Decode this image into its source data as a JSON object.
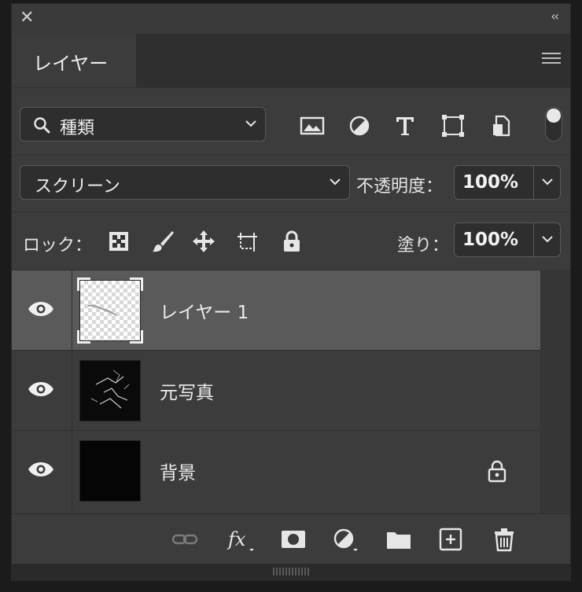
{
  "panel": {
    "tab_label": "レイヤー",
    "filter": {
      "selected": "種類"
    },
    "blend_mode": {
      "selected": "スクリーン"
    },
    "opacity": {
      "label": "不透明度：",
      "value": "100%"
    },
    "lock": {
      "label": "ロック："
    },
    "fill": {
      "label": "塗り：",
      "value": "100%"
    },
    "layers": [
      {
        "name": "レイヤー 1",
        "visible": true,
        "selected": true,
        "locked": false
      },
      {
        "name": "元写真",
        "visible": true,
        "selected": false,
        "locked": false
      },
      {
        "name": "背景",
        "visible": true,
        "selected": false,
        "locked": true
      }
    ],
    "filter_icons": [
      "image-filter-icon",
      "adjustment-filter-icon",
      "type-filter-icon",
      "shape-filter-icon",
      "smart-object-filter-icon"
    ],
    "lock_icons": [
      "lock-transparent-pixels-icon",
      "lock-image-pixels-icon",
      "lock-position-icon",
      "lock-artboard-icon",
      "lock-all-icon"
    ],
    "bottom_icons": [
      "link-layers-icon",
      "fx-icon",
      "add-mask-icon",
      "new-adjustment-layer-icon",
      "new-group-icon",
      "new-layer-icon",
      "delete-layer-icon"
    ]
  }
}
